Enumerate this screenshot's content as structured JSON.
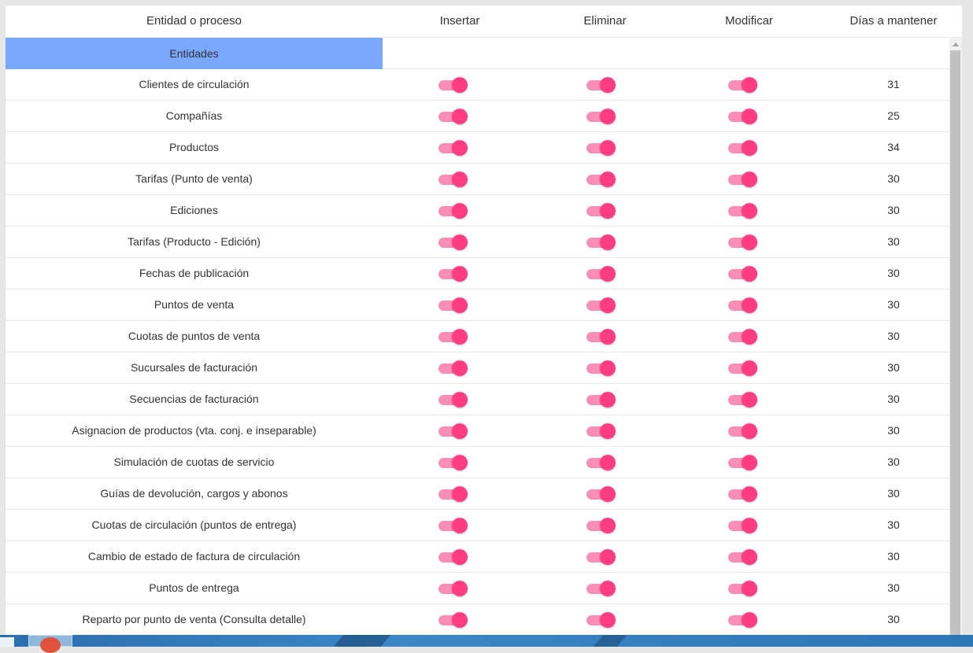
{
  "table": {
    "columns": [
      "Entidad o proceso",
      "Insertar",
      "Eliminar",
      "Modificar",
      "Días a mantener"
    ],
    "section": "Entidades",
    "rows": [
      {
        "name": "Clientes de circulación",
        "insert": true,
        "delete": true,
        "modify": true,
        "days": "31"
      },
      {
        "name": "Compañías",
        "insert": true,
        "delete": true,
        "modify": true,
        "days": "25"
      },
      {
        "name": "Productos",
        "insert": true,
        "delete": true,
        "modify": true,
        "days": "34"
      },
      {
        "name": "Tarifas (Punto de venta)",
        "insert": true,
        "delete": true,
        "modify": true,
        "days": "30"
      },
      {
        "name": "Ediciones",
        "insert": true,
        "delete": true,
        "modify": true,
        "days": "30"
      },
      {
        "name": "Tarifas (Producto - Edición)",
        "insert": true,
        "delete": true,
        "modify": true,
        "days": "30"
      },
      {
        "name": "Fechas de publicación",
        "insert": true,
        "delete": true,
        "modify": true,
        "days": "30"
      },
      {
        "name": "Puntos de venta",
        "insert": true,
        "delete": true,
        "modify": true,
        "days": "30"
      },
      {
        "name": "Cuotas de puntos de venta",
        "insert": true,
        "delete": true,
        "modify": true,
        "days": "30"
      },
      {
        "name": "Sucursales de facturación",
        "insert": true,
        "delete": true,
        "modify": true,
        "days": "30"
      },
      {
        "name": "Secuencias de facturación",
        "insert": true,
        "delete": true,
        "modify": true,
        "days": "30"
      },
      {
        "name": "Asignacion de productos (vta. conj. e inseparable)",
        "insert": true,
        "delete": true,
        "modify": true,
        "days": "30"
      },
      {
        "name": "Simulación de cuotas de servicio",
        "insert": true,
        "delete": true,
        "modify": true,
        "days": "30"
      },
      {
        "name": "Guías de devolución, cargos y abonos",
        "insert": true,
        "delete": true,
        "modify": true,
        "days": "30"
      },
      {
        "name": "Cuotas de circulación (puntos de entrega)",
        "insert": true,
        "delete": true,
        "modify": true,
        "days": "30"
      },
      {
        "name": "Cambio de estado de factura de circulación",
        "insert": true,
        "delete": true,
        "modify": true,
        "days": "30"
      },
      {
        "name": "Puntos de entrega",
        "insert": true,
        "delete": true,
        "modify": true,
        "days": "30"
      },
      {
        "name": "Reparto por punto de venta (Consulta detalle)",
        "insert": true,
        "delete": true,
        "modify": true,
        "days": "30"
      }
    ]
  },
  "colors": {
    "section_bg": "#7aa7ff",
    "toggle_track": "#f98db4",
    "toggle_knob": "#ff3d82"
  },
  "icons": {
    "toggle": "toggle-switch-icon",
    "scroll_up": "chevron-up-icon"
  }
}
